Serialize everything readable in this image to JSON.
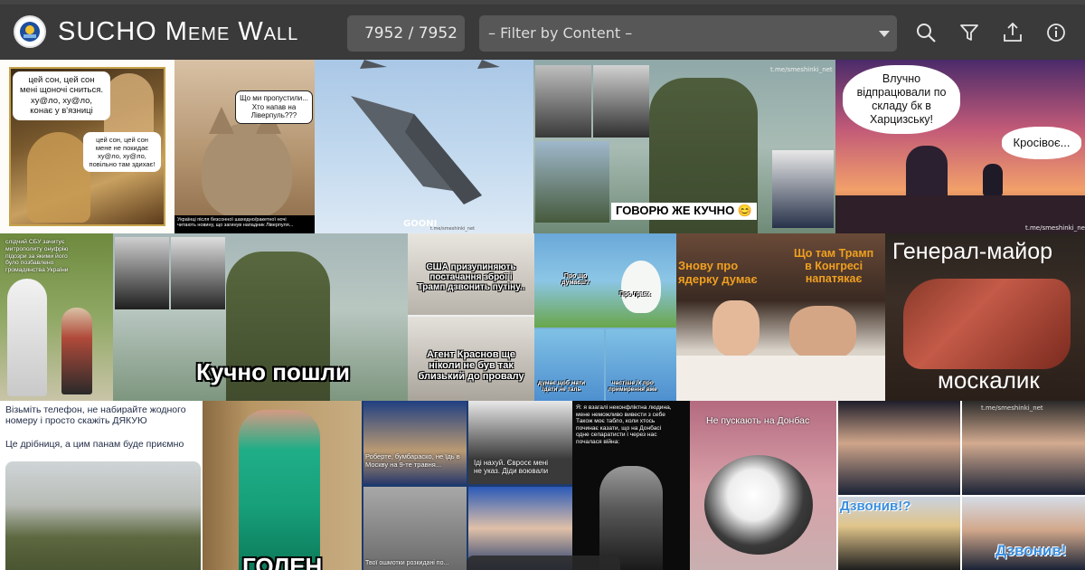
{
  "app": {
    "title": "SUCHO Meme Wall",
    "counter": "7952 / 7952",
    "filter_placeholder": "– Filter by Content –"
  },
  "toolbar": {
    "icons": [
      "search-icon",
      "filter-icon",
      "upload-icon",
      "info-icon"
    ]
  },
  "memes": [
    {
      "name": "meme-poet-dream",
      "texts": [
        "цей сон, цей сон\nмені щоночі сниться.\nху@ло, ху@ло,\nконає у в'язниці",
        "цей сон, цей сон\nмене не покидає\nху@ло, ху@ло,\nповільно там здихає!"
      ]
    },
    {
      "name": "meme-cat-liverpool",
      "texts": [
        "Що ми пропустили...\nХто напав на\nЛіверпуль???",
        "Українці після безсонної шахедно/ракетної ночі\nчитають новину, що загинув нападник Ліверпуля..."
      ]
    },
    {
      "name": "meme-shahed-drones",
      "texts": [
        "GOONI",
        "t.me/smeshinki_net"
      ]
    },
    {
      "name": "meme-general-shooting",
      "texts": [
        "ГОВОРЮ ЖЕ КУЧНО 😊",
        "t.me/smeshinki_net"
      ]
    },
    {
      "name": "meme-khartsyzk-sunset",
      "texts": [
        "Влучно\nвідпрацювали по\nскладу бк в\nХарцизську!",
        "Кросівоє...",
        "t.me/smeshinki_net"
      ]
    },
    {
      "name": "meme-gandalf",
      "texts": [
        "слідчий СБУ зачитує\nмитрополиту онуфрію\nпідозри за якими його\nбуло позбавлено\nгромадянства України"
      ]
    },
    {
      "name": "meme-kuchno-poshly",
      "texts": [
        "Кучно пошли"
      ]
    },
    {
      "name": "meme-harold",
      "texts": [
        "США призупиняють\nпостачання зброї і\nТрамп дзвонить путіну..",
        "Агент Краснов ще\nніколи не був так\nблизький до провалу"
      ]
    },
    {
      "name": "meme-moomin",
      "texts": [
        "Про що\nдумаєш?",
        "Про граях",
        "думає щоб мати\nїдати не таль",
        "частіше їх про\nпримирення вже"
      ]
    },
    {
      "name": "meme-bed-trump",
      "texts": [
        "Знову про\nядерку думає",
        "Що там Трамп\nв Конгресі\nнапатякає"
      ]
    },
    {
      "name": "meme-general-major",
      "texts": [
        "Генерал-майор",
        "москалик"
      ]
    },
    {
      "name": "meme-budanov-call",
      "texts": [
        "Візьміть телефон, не набирайте жодного\nномеру і просто скажіть ДЯКУЮ",
        "Це дрібниця, а цим панам буде приємно"
      ]
    },
    {
      "name": "meme-green-jacket",
      "texts": [
        "ГОЛЕН"
      ]
    },
    {
      "name": "meme-fico-vdl",
      "texts": [
        "Роберте, бумбараско, не їдь в\nМоскву на 9-те травня...",
        "Іді нахуй. Євросє мені\nне указ. Діди воювали",
        "Твої ошмотки розкидані по..."
      ]
    },
    {
      "name": "meme-landa",
      "texts": [
        "Я: я взагалі неконфліктна людина,\nмене неможливо вивести з себе\nТакож моє табло, коли хтось\nпочинає казати, що на Донбасі\nодне сепаратисти і через нас\nпочалася війна:"
      ]
    },
    {
      "name": "meme-cat-donbas",
      "texts": [
        "Не пускають на Донбас"
      ]
    },
    {
      "name": "meme-macron-call",
      "texts": [
        "t.me/smeshinki_net",
        "Дзвонив!?",
        "Дзвонив!"
      ]
    }
  ]
}
